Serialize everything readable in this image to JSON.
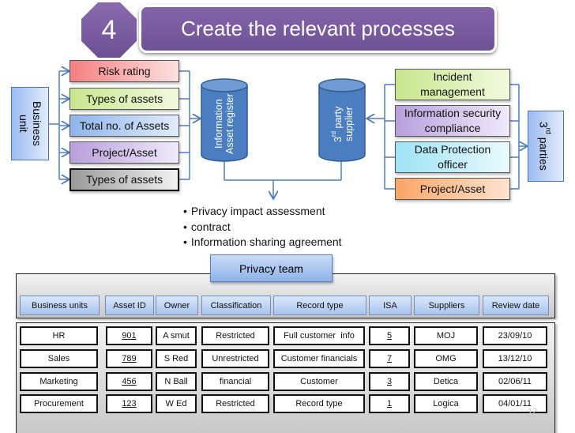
{
  "header": {
    "step_number": "4",
    "title": "Create the relevant processes"
  },
  "left": {
    "business_unit": "Business unit",
    "items": [
      {
        "label": "Risk rating",
        "color": "#f47f7f"
      },
      {
        "label": "Types of assets",
        "color": "#c8e68e"
      },
      {
        "label": "Total no. of Assets",
        "color": "#8db4ea"
      },
      {
        "label": "Project/Asset",
        "color": "#b79fdb"
      },
      {
        "label": "Types of assets",
        "color": "#9a9a9a"
      }
    ]
  },
  "cylinders": {
    "asset_register": "Information Asset register",
    "supplier_prefix": "3",
    "supplier_sup": "rd",
    "supplier_rest": " party supplier"
  },
  "right": {
    "third_parties_prefix": "3",
    "third_parties_sup": "rd",
    "third_parties_rest": " parties",
    "items": [
      {
        "label": "Incident management",
        "color": "#c8e68e"
      },
      {
        "label": "Information security compliance",
        "color": "#b79fdb"
      },
      {
        "label": "Data Protection officer",
        "color": "#9ee3f5"
      },
      {
        "label": "Project/Asset",
        "color": "#f9a566"
      }
    ]
  },
  "outputs": [
    "Privacy impact assessment",
    "contract",
    "Information sharing agreement"
  ],
  "privacy_team": "Privacy team",
  "table": {
    "headers": [
      "Business units",
      "Asset ID",
      "Owner",
      "Classification",
      "Record type",
      "ISA",
      "Suppliers",
      "Review date"
    ],
    "rows": [
      [
        "HR",
        "901",
        "A smut",
        "Restricted",
        "Full customer  info",
        "5",
        "MOJ",
        "23/09/10"
      ],
      [
        "Sales",
        "789",
        "S Red",
        "Unrestricted",
        "Customer financials",
        "7",
        "OMG",
        "13/12/10"
      ],
      [
        "Marketing",
        "456",
        "N Ball",
        "financial",
        "Customer",
        "3",
        "Detica",
        "02/06/11"
      ],
      [
        "Procurement",
        "123",
        "W Ed",
        "Restricted",
        "Record type",
        "1",
        "Logica",
        "04/01/11"
      ]
    ]
  },
  "page_number": "12"
}
